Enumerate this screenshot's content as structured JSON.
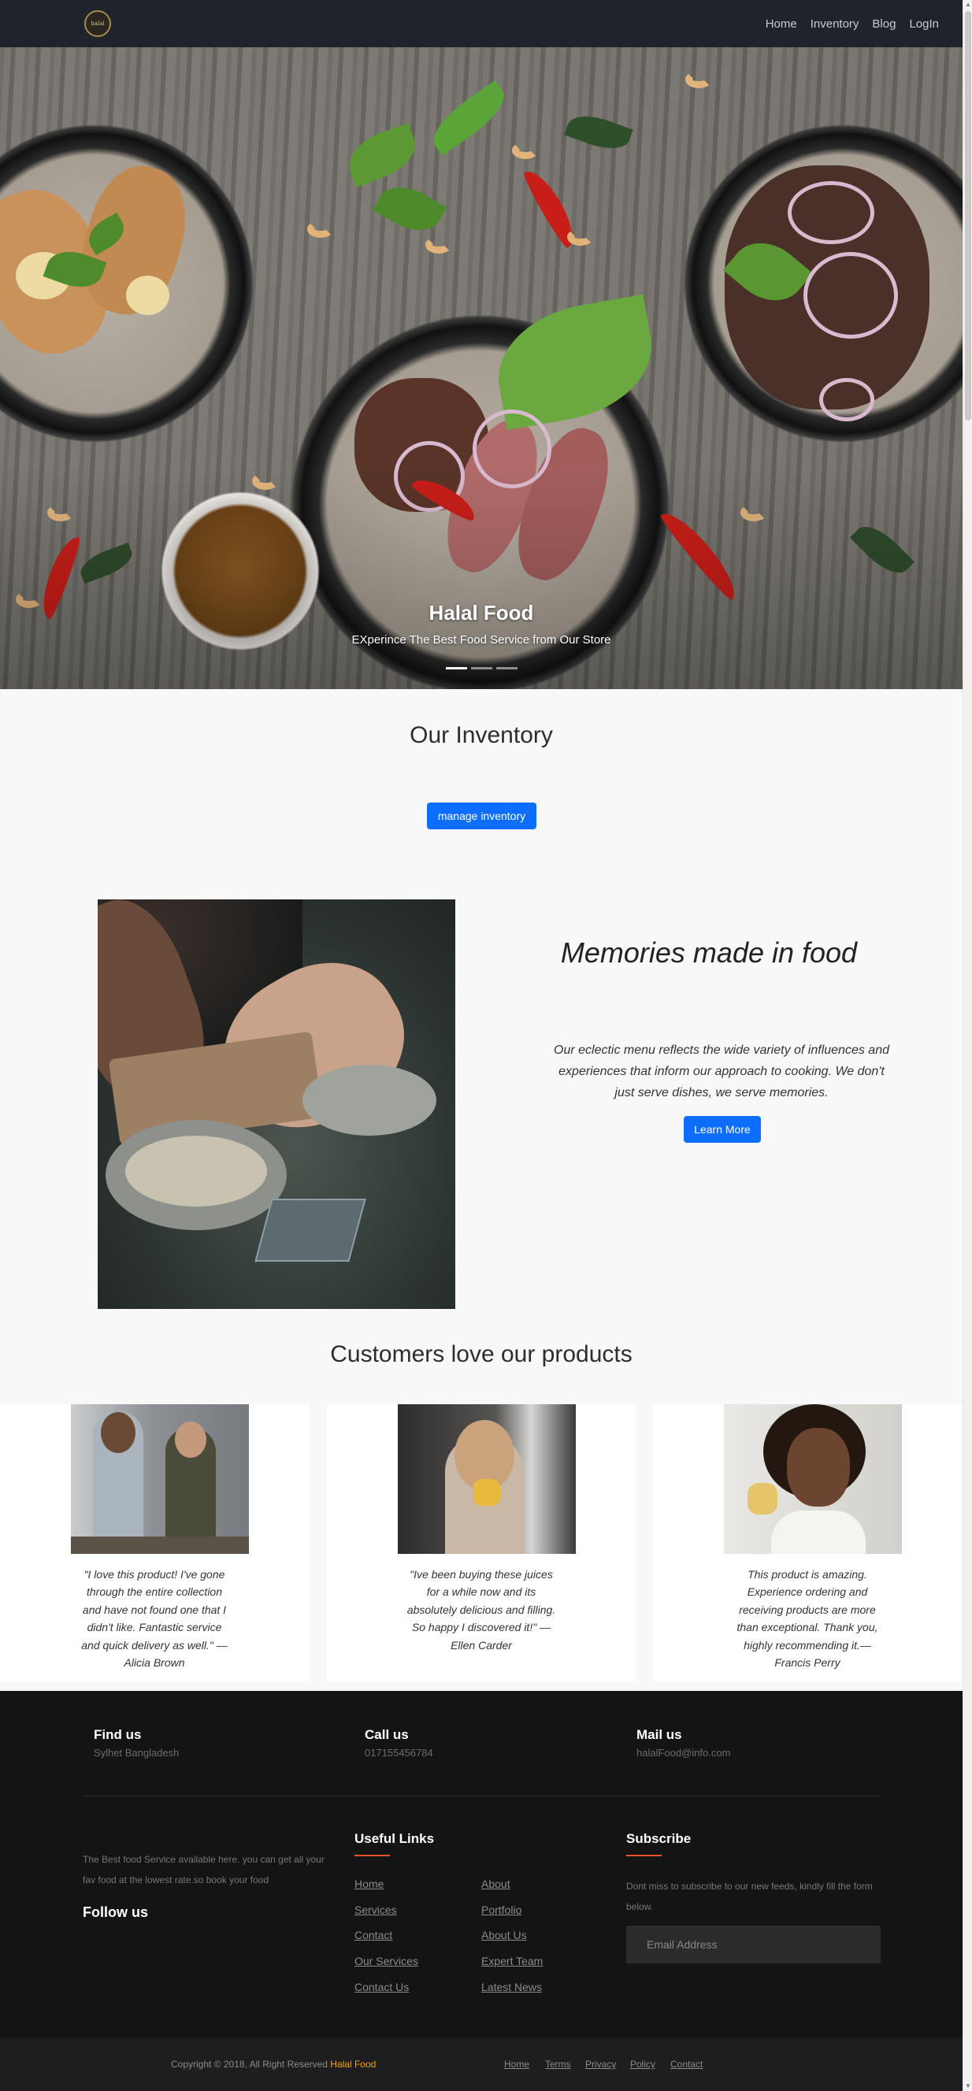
{
  "nav": {
    "logo_text": "halal",
    "items": [
      "Home",
      "Inventory",
      "Blog",
      "LogIn"
    ]
  },
  "hero": {
    "title": "Halal Food",
    "subtitle": "EXperince The Best Food Service from Our Store",
    "slides": 3,
    "active_slide": 1
  },
  "inventory": {
    "title": "Our Inventory",
    "button_label": "manage inventory"
  },
  "memories": {
    "title": "Memories made in food",
    "text": "Our eclectic menu reflects the wide variety of influences and experiences that inform our approach to cooking. We don't just serve dishes, we serve memories.",
    "button_label": "Learn More"
  },
  "customers": {
    "title": "Customers love our products",
    "testimonials": [
      {
        "text": "\"I love this product! I've gone through the entire collection and have not found one that I didn't like. Fantastic service and quick delivery as well.\" — Alicia Brown"
      },
      {
        "text": "\"Ive been buying these juices for a while now and its absolutely delicious and filling. So happy I discovered it!\" — Ellen Carder"
      },
      {
        "text": "This product is amazing. Experience ordering and receiving products are more than exceptional. Thank you, highly recommending it.— Francis Perry"
      }
    ]
  },
  "footer": {
    "find_us": {
      "title": "Find us",
      "value": "Sylhet Bangladesh"
    },
    "call_us": {
      "title": "Call us",
      "value": "017155456784"
    },
    "mail_us": {
      "title": "Mail us",
      "value": "halalFood@info.com"
    },
    "about_text": "The Best food Service available here. you can get all your fav food at the lowest rate.so book your food",
    "follow_us": "Follow us",
    "useful_links": {
      "title": "Useful Links",
      "col1": [
        "Home",
        "Services",
        "Contact",
        "Our Services",
        "Contact Us"
      ],
      "col2": [
        "About",
        "Portfolio",
        "About Us",
        "Expert Team",
        "Latest News"
      ]
    },
    "subscribe": {
      "title": "Subscribe",
      "text": "Dont miss to subscribe to our new feeds, kindly fill the form below.",
      "placeholder": "Email Address"
    }
  },
  "bottom": {
    "copyright": "Copyright © 2018, All Right Reserved",
    "brand": "Halal Food",
    "links": [
      "Home",
      "Terms",
      "Privacy",
      "Policy",
      "Contact"
    ]
  },
  "colors": {
    "navbar": "#20232a",
    "primary_button": "#0d6efd",
    "footer_bg": "#141414",
    "accent_underline": "#e8562a",
    "brand_highlight": "#f0a500"
  }
}
